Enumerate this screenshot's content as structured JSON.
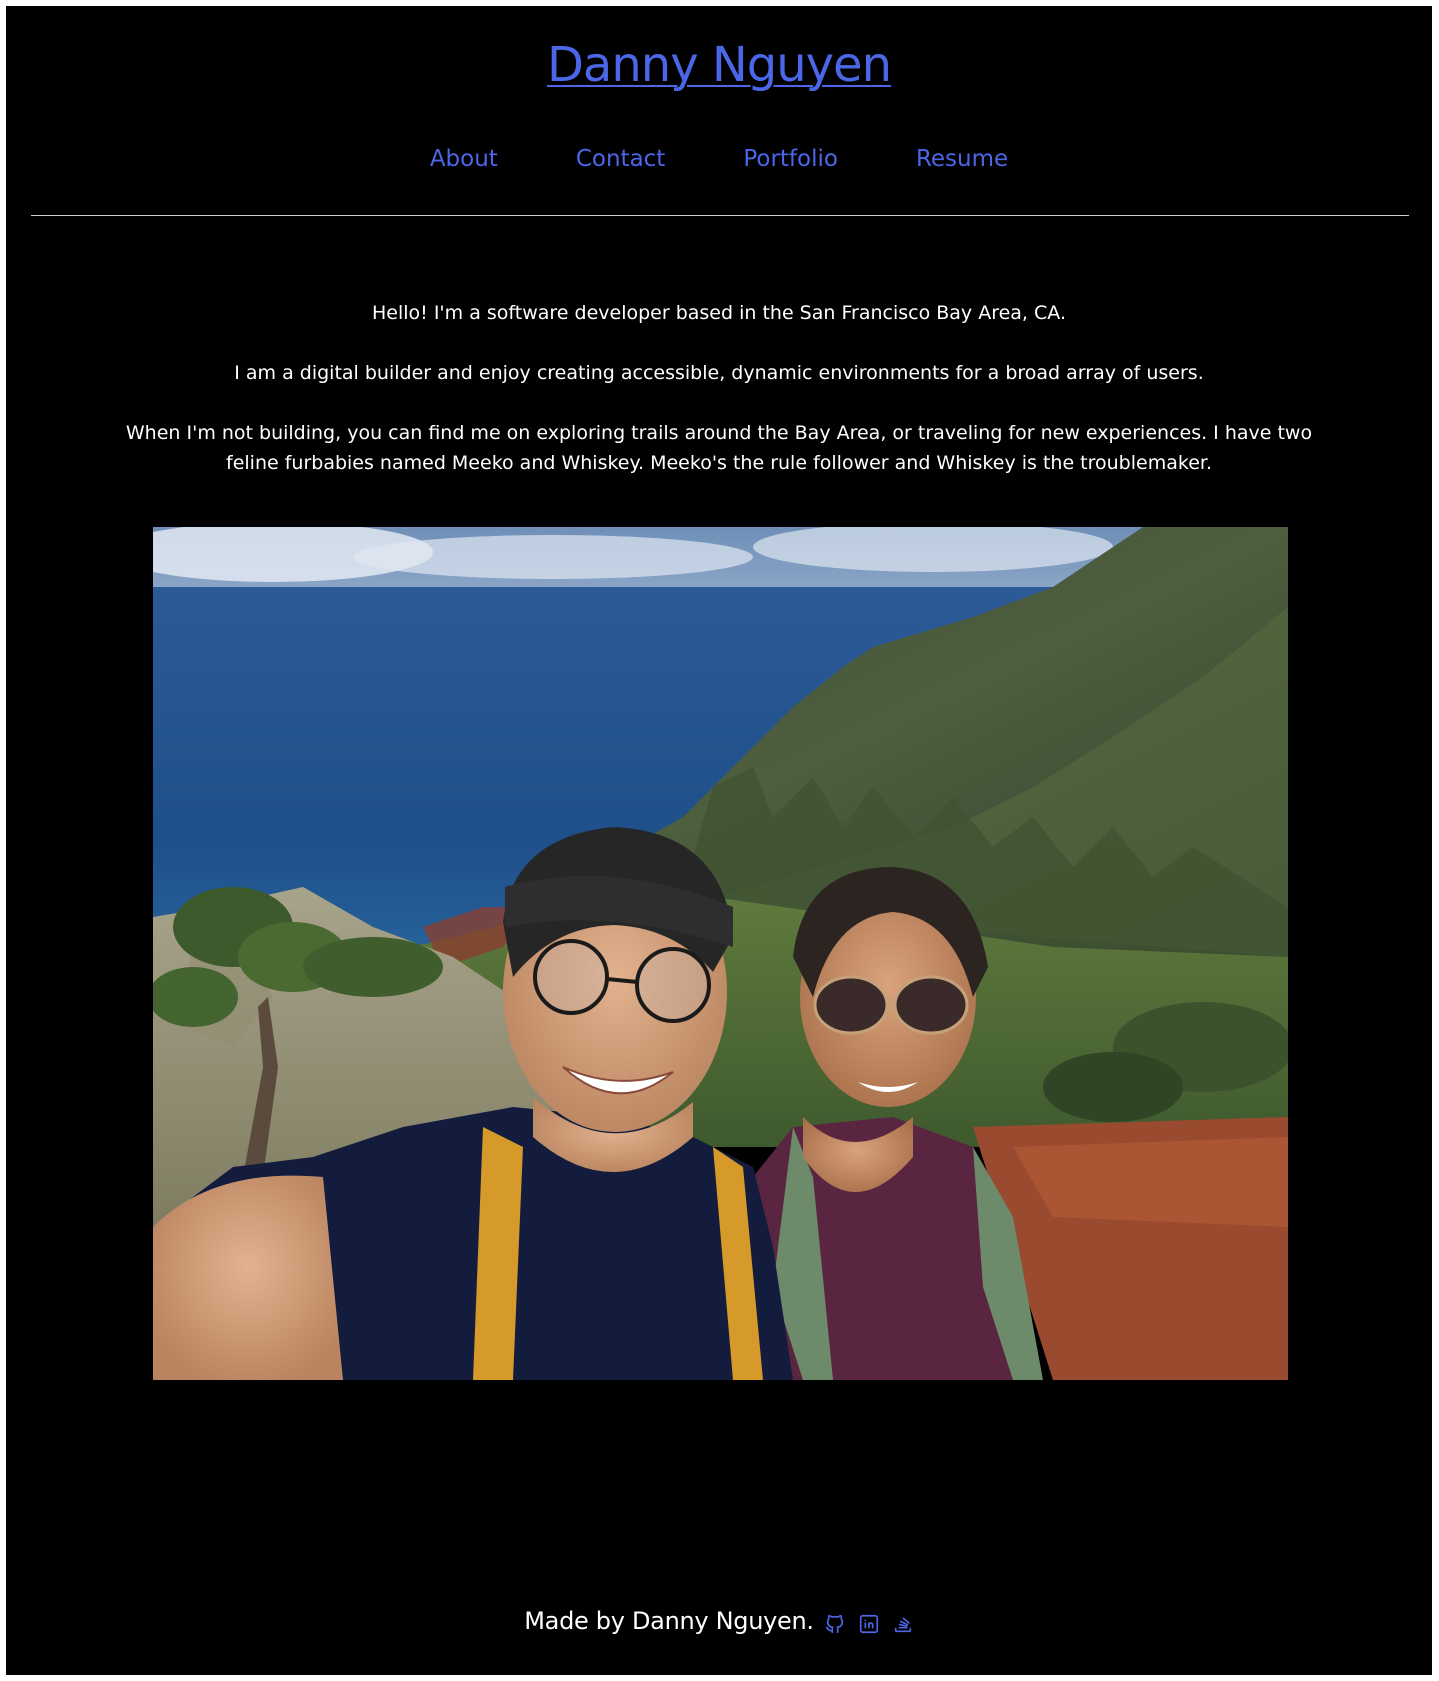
{
  "header": {
    "title": "Danny Nguyen"
  },
  "nav": {
    "items": [
      {
        "label": "About"
      },
      {
        "label": "Contact"
      },
      {
        "label": "Portfolio"
      },
      {
        "label": "Resume"
      }
    ]
  },
  "intro": {
    "paragraphs": [
      "Hello! I'm a software developer based in the San Francisco Bay Area, CA.",
      "I am a digital builder and enjoy creating accessible, dynamic environments for a broad array of users.",
      "When I'm not building, you can find me on exploring trails around the Bay Area, or traveling for new experiences. I have two feline furbabies named Meeko and Whiskey. Meeko's the rule follower and Whiskey is the troublemaker."
    ]
  },
  "footer": {
    "text": "Made by Danny Nguyen.",
    "icons": [
      "github-icon",
      "linkedin-icon",
      "stackoverflow-icon"
    ]
  },
  "colors": {
    "background": "#000000",
    "link": "#4b67e8",
    "text": "#ffffff",
    "divider": "#cfcfcf"
  }
}
